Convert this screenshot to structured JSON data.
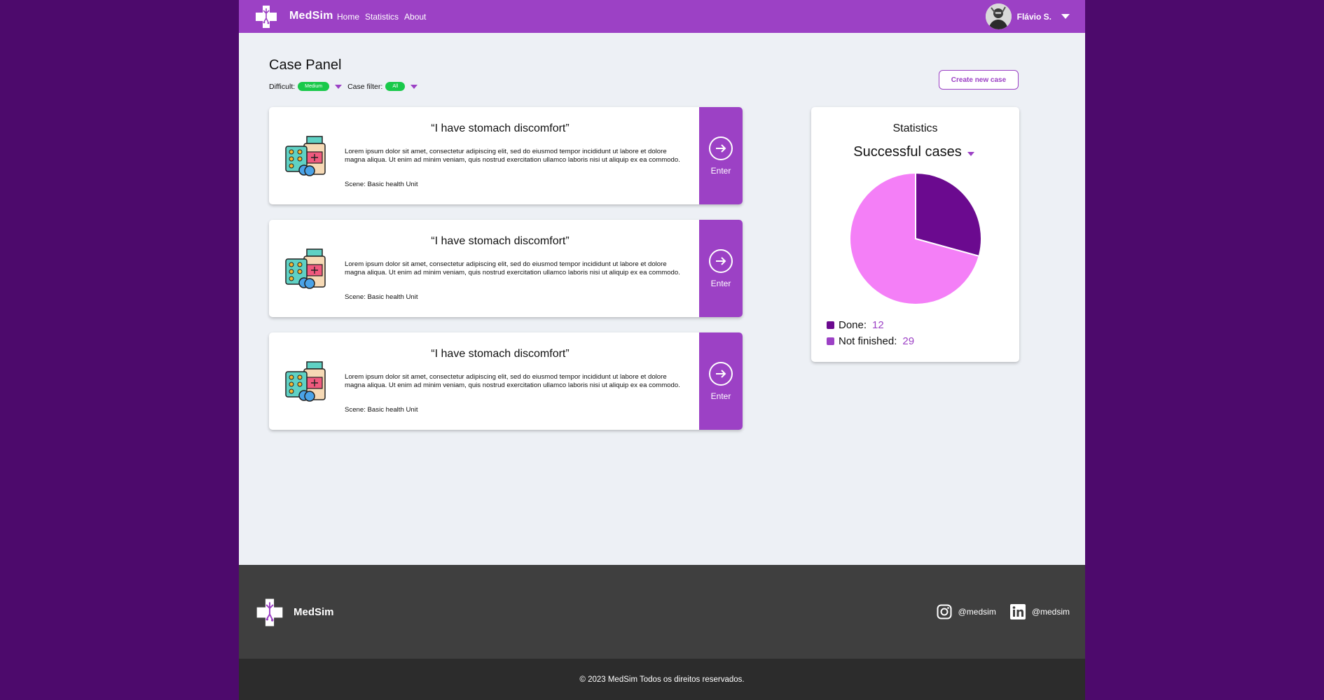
{
  "header": {
    "brand": "MedSim",
    "nav": [
      "Home",
      "Statistics",
      "About"
    ],
    "user_name": "Flávio S."
  },
  "panel": {
    "title": "Case Panel",
    "difficulty_label": "Difficult:",
    "difficulty_value": "Medium",
    "case_filter_label": "Case filter:",
    "case_filter_value": "All",
    "create_button": "Create new case"
  },
  "cases": [
    {
      "title": "“I have stomach discomfort”",
      "description": "Lorem ipsum dolor sit amet, consectetur adipiscing elit, sed do eiusmod tempor incididunt ut labore et dolore magna aliqua. Ut enim ad minim veniam, quis nostrud exercitation ullamco laboris nisi ut aliquip ex ea commodo.",
      "scene": "Scene: Basic health Unit",
      "enter_label": "Enter"
    },
    {
      "title": "“I have stomach discomfort”",
      "description": "Lorem ipsum dolor sit amet, consectetur adipiscing elit, sed do eiusmod tempor incididunt ut labore et dolore magna aliqua. Ut enim ad minim veniam, quis nostrud exercitation ullamco laboris nisi ut aliquip ex ea commodo.",
      "scene": "Scene: Basic health Unit",
      "enter_label": "Enter"
    },
    {
      "title": "“I have stomach discomfort”",
      "description": "Lorem ipsum dolor sit amet, consectetur adipiscing elit, sed do eiusmod tempor incididunt ut labore et dolore magna aliqua. Ut enim ad minim veniam, quis nostrud exercitation ullamco laboris nisi ut aliquip ex ea commodo.",
      "scene": "Scene: Basic health Unit",
      "enter_label": "Enter"
    }
  ],
  "statistics": {
    "title": "Statistics",
    "selected_metric": "Successful cases",
    "legend": [
      {
        "label": "Done:",
        "value": "12",
        "color": "#6b0a8f"
      },
      {
        "label": "Not finished:",
        "value": "29",
        "color": "#9c41c5"
      }
    ],
    "chart_data": {
      "type": "pie",
      "slices": [
        {
          "label": "Done",
          "value": 12,
          "color": "#6b0a8f"
        },
        {
          "label": "Not finished",
          "value": 29,
          "color": "#f47ff7"
        }
      ]
    }
  },
  "footer": {
    "brand": "MedSim",
    "instagram": "@medsim",
    "linkedin": "@medsim",
    "copyright": "© 2023 MedSim Todos os direitos reservados."
  },
  "colors": {
    "accent": "#9c41c5",
    "page_bg": "#4d0a6c",
    "pill": "#19c94a",
    "footer": "#3f3f3f"
  }
}
